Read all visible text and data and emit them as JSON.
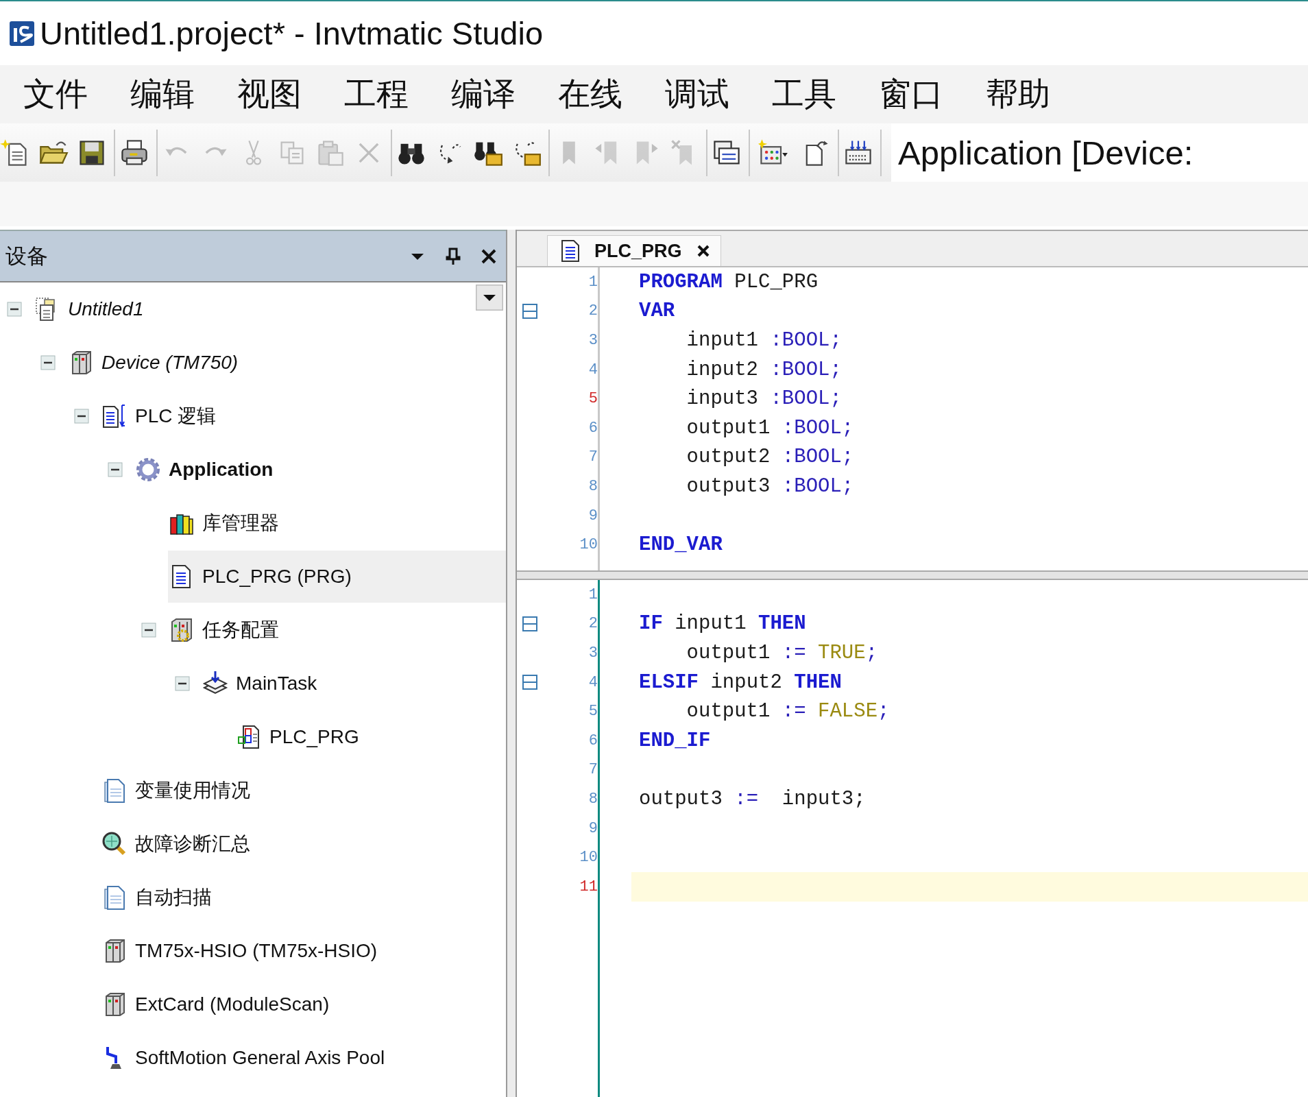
{
  "window": {
    "title": "Untitled1.project* - Invtmatic Studio"
  },
  "menu": [
    "文件",
    "编辑",
    "视图",
    "工程",
    "编译",
    "在线",
    "调试",
    "工具",
    "窗口",
    "帮助"
  ],
  "toolbar": {
    "groups": [
      {
        "buttons": [
          {
            "kind": "new",
            "disabled": false
          },
          {
            "kind": "open",
            "disabled": false
          },
          {
            "kind": "save",
            "disabled": false
          }
        ]
      },
      {
        "buttons": [
          {
            "kind": "print",
            "disabled": false
          }
        ]
      },
      {
        "buttons": [
          {
            "kind": "undo",
            "disabled": true
          },
          {
            "kind": "redo",
            "disabled": true
          },
          {
            "kind": "cut",
            "disabled": true
          },
          {
            "kind": "copy",
            "disabled": true
          },
          {
            "kind": "paste",
            "disabled": true
          },
          {
            "kind": "delete",
            "disabled": true
          }
        ]
      },
      {
        "buttons": [
          {
            "kind": "find",
            "disabled": false
          },
          {
            "kind": "replace",
            "disabled": false
          },
          {
            "kind": "find-files",
            "disabled": false
          },
          {
            "kind": "replace-files",
            "disabled": false
          }
        ]
      },
      {
        "buttons": [
          {
            "kind": "bookmark",
            "disabled": true
          },
          {
            "kind": "prev-bookmark",
            "disabled": true
          },
          {
            "kind": "next-bookmark",
            "disabled": true
          },
          {
            "kind": "clear-bookmarks",
            "disabled": true
          }
        ]
      },
      {
        "buttons": [
          {
            "kind": "windows",
            "disabled": false
          }
        ]
      },
      {
        "buttons": [
          {
            "kind": "insert-menu",
            "disabled": false
          },
          {
            "kind": "export",
            "disabled": false
          }
        ]
      },
      {
        "buttons": [
          {
            "kind": "download",
            "disabled": false
          }
        ]
      }
    ],
    "context": "Application [Device:"
  },
  "devices_panel": {
    "title": "设备",
    "tree": [
      {
        "label": "Untitled1",
        "kind": "project",
        "selected": false,
        "expanded": true,
        "children": [
          {
            "label": "Device (TM750)",
            "kind": "controller",
            "selected": false,
            "expanded": true,
            "children": [
              {
                "label": "PLC 逻辑",
                "kind": "logic",
                "selected": false,
                "expanded": true,
                "children": [
                  {
                    "label": "Application",
                    "kind": "application",
                    "selected": false,
                    "expanded": true,
                    "children": [
                      {
                        "label": "库管理器",
                        "kind": "library",
                        "selected": false
                      },
                      {
                        "label": "PLC_PRG (PRG)",
                        "kind": "pou",
                        "selected": true
                      },
                      {
                        "label": "任务配置",
                        "kind": "task-config",
                        "selected": false,
                        "expanded": true,
                        "children": [
                          {
                            "label": "MainTask",
                            "kind": "task",
                            "selected": false,
                            "expanded": true,
                            "children": [
                              {
                                "label": "PLC_PRG",
                                "kind": "pou-call",
                                "selected": false
                              }
                            ]
                          }
                        ]
                      }
                    ]
                  }
                ]
              },
              {
                "label": "变量使用情况",
                "kind": "document",
                "selected": false
              },
              {
                "label": "故障诊断汇总",
                "kind": "diagnosis",
                "selected": false
              },
              {
                "label": "自动扫描",
                "kind": "document",
                "selected": false
              },
              {
                "label": "TM75x-HSIO (TM75x-HSIO)",
                "kind": "device",
                "selected": false
              },
              {
                "label": "ExtCard (ModuleScan)",
                "kind": "device",
                "selected": false
              },
              {
                "label": "SoftMotion General Axis Pool",
                "kind": "axis",
                "selected": false
              }
            ]
          }
        ]
      }
    ]
  },
  "editor": {
    "tabs": [
      {
        "label": "PLC_PRG",
        "selected": true
      }
    ],
    "declaration": {
      "lines": [
        {
          "number": "1",
          "fold": false,
          "modified": false,
          "current": false,
          "indented": false,
          "tokens": [
            {
              "kind": "keyword",
              "text": "PROGRAM"
            },
            {
              "kind": "plain",
              "text": " PLC_PRG"
            }
          ]
        },
        {
          "number": "2",
          "fold": true,
          "modified": false,
          "current": false,
          "indented": false,
          "tokens": [
            {
              "kind": "keyword",
              "text": "VAR"
            }
          ]
        },
        {
          "number": "3",
          "fold": false,
          "modified": false,
          "current": false,
          "indented": true,
          "tokens": [
            {
              "kind": "plain",
              "text": "input1 "
            },
            {
              "kind": "type",
              "text": ":BOOL;"
            }
          ]
        },
        {
          "number": "4",
          "fold": false,
          "modified": false,
          "current": false,
          "indented": true,
          "tokens": [
            {
              "kind": "plain",
              "text": "input2 "
            },
            {
              "kind": "type",
              "text": ":BOOL;"
            }
          ]
        },
        {
          "number": "5",
          "fold": false,
          "modified": true,
          "current": false,
          "indented": true,
          "tokens": [
            {
              "kind": "plain",
              "text": "input3 "
            },
            {
              "kind": "type",
              "text": ":BOOL;"
            }
          ]
        },
        {
          "number": "6",
          "fold": false,
          "modified": false,
          "current": false,
          "indented": true,
          "tokens": [
            {
              "kind": "plain",
              "text": "output1 "
            },
            {
              "kind": "type",
              "text": ":BOOL;"
            }
          ]
        },
        {
          "number": "7",
          "fold": false,
          "modified": false,
          "current": false,
          "indented": true,
          "tokens": [
            {
              "kind": "plain",
              "text": "output2 "
            },
            {
              "kind": "type",
              "text": ":BOOL;"
            }
          ]
        },
        {
          "number": "8",
          "fold": false,
          "modified": false,
          "current": false,
          "indented": true,
          "tokens": [
            {
              "kind": "plain",
              "text": "output3 "
            },
            {
              "kind": "type",
              "text": ":BOOL;"
            }
          ]
        },
        {
          "number": "9",
          "fold": false,
          "modified": false,
          "current": false
        },
        {
          "number": "10",
          "fold": false,
          "modified": false,
          "current": false,
          "indented": false,
          "tokens": [
            {
              "kind": "keyword",
              "text": "END_VAR"
            }
          ]
        }
      ]
    },
    "implementation": {
      "lines": [
        {
          "number": "1",
          "fold": false,
          "modified": false,
          "current": false
        },
        {
          "number": "2",
          "fold": true,
          "modified": false,
          "current": false,
          "indented": false,
          "tokens": [
            {
              "kind": "keyword",
              "text": "IF"
            },
            {
              "kind": "plain",
              "text": " input1 "
            },
            {
              "kind": "keyword",
              "text": "THEN"
            }
          ]
        },
        {
          "number": "3",
          "fold": false,
          "modified": false,
          "current": false,
          "indented": true,
          "tokens": [
            {
              "kind": "plain",
              "text": "output1 "
            },
            {
              "kind": "type",
              "text": ":= "
            },
            {
              "kind": "literal",
              "text": "TRUE"
            },
            {
              "kind": "type",
              "text": ";"
            }
          ]
        },
        {
          "number": "4",
          "fold": true,
          "modified": false,
          "current": false,
          "indented": false,
          "tokens": [
            {
              "kind": "keyword",
              "text": "ELSIF"
            },
            {
              "kind": "plain",
              "text": " input2 "
            },
            {
              "kind": "keyword",
              "text": "THEN"
            }
          ]
        },
        {
          "number": "5",
          "fold": false,
          "modified": false,
          "current": false,
          "indented": true,
          "tokens": [
            {
              "kind": "plain",
              "text": "output1 "
            },
            {
              "kind": "type",
              "text": ":= "
            },
            {
              "kind": "literal",
              "text": "FALSE"
            },
            {
              "kind": "type",
              "text": ";"
            }
          ]
        },
        {
          "number": "6",
          "fold": false,
          "modified": false,
          "current": false,
          "indented": false,
          "tokens": [
            {
              "kind": "keyword",
              "text": "END_IF"
            }
          ]
        },
        {
          "number": "7",
          "fold": false,
          "modified": false,
          "current": false
        },
        {
          "number": "8",
          "fold": false,
          "modified": false,
          "current": false,
          "indented": false,
          "tokens": [
            {
              "kind": "plain",
              "text": "output3 "
            },
            {
              "kind": "type",
              "text": ":="
            },
            {
              "kind": "plain",
              "text": "  input3;"
            }
          ]
        },
        {
          "number": "9",
          "fold": false,
          "modified": false,
          "current": false
        },
        {
          "number": "10",
          "fold": false,
          "modified": false,
          "current": false
        },
        {
          "number": "11",
          "fold": false,
          "modified": true,
          "current": true
        }
      ]
    }
  }
}
